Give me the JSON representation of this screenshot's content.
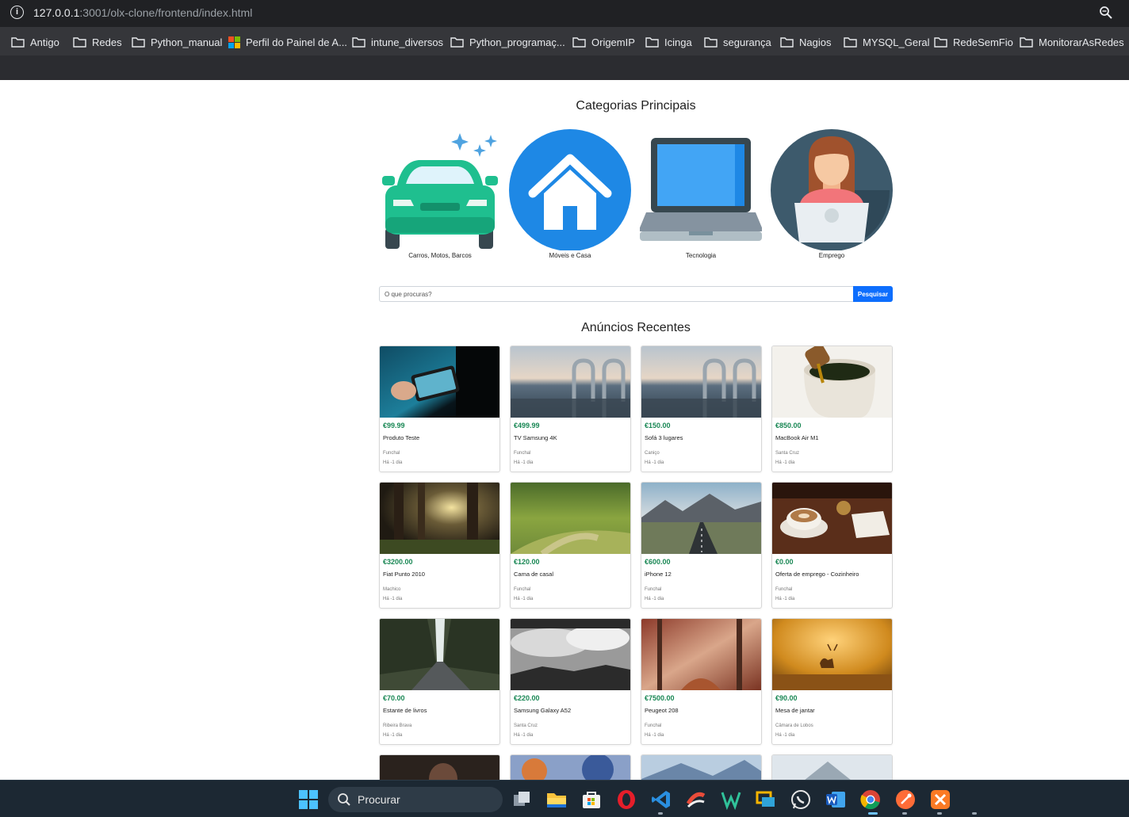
{
  "browser": {
    "url_host": "127.0.0.1",
    "url_rest": ":3001/olx-clone/frontend/index.html",
    "bookmarks": [
      "Antigo",
      "Redes",
      "Python_manual",
      "Perfil do Painel de A...",
      "intune_diversos",
      "Python_programaç...",
      "OrigemIP",
      "Icinga",
      "segurança",
      "Nagios",
      "MYSQL_Geral",
      "RedeSemFio",
      "MonitorarAsRedes"
    ]
  },
  "categories": {
    "title": "Categorias Principais",
    "items": [
      {
        "label": "Carros, Motos, Barcos",
        "icon": "car-icon"
      },
      {
        "label": "Móveis e Casa",
        "icon": "house-icon"
      },
      {
        "label": "Tecnologia",
        "icon": "laptop-icon"
      },
      {
        "label": "Emprego",
        "icon": "person-laptop-icon"
      }
    ]
  },
  "search": {
    "placeholder": "O que procuras?",
    "button": "Pesquisar"
  },
  "listings": {
    "title": "Anúncios Recentes",
    "items": [
      {
        "price": "€99.99",
        "title": "Produto Teste",
        "location": "Funchal",
        "date": "Há -1 dia"
      },
      {
        "price": "€499.99",
        "title": "TV Samsung 4K",
        "location": "Funchal",
        "date": "Há -1 dia"
      },
      {
        "price": "€150.00",
        "title": "Sofá 3 lugares",
        "location": "Caniço",
        "date": "Há -1 dia"
      },
      {
        "price": "€850.00",
        "title": "MacBook Air M1",
        "location": "Santa Cruz",
        "date": "Há -1 dia"
      },
      {
        "price": "€3200.00",
        "title": "Fiat Punto 2010",
        "location": "Machico",
        "date": "Há -1 dia"
      },
      {
        "price": "€120.00",
        "title": "Cama de casal",
        "location": "Funchal",
        "date": "Há -1 dia"
      },
      {
        "price": "€600.00",
        "title": "iPhone 12",
        "location": "Funchal",
        "date": "Há -1 dia"
      },
      {
        "price": "€0.00",
        "title": "Oferta de emprego - Cozinheiro",
        "location": "Funchal",
        "date": "Há -1 dia"
      },
      {
        "price": "€70.00",
        "title": "Estante de livros",
        "location": "Ribeira Brava",
        "date": "Há -1 dia"
      },
      {
        "price": "€220.00",
        "title": "Samsung Galaxy A52",
        "location": "Santa Cruz",
        "date": "Há -1 dia"
      },
      {
        "price": "€7500.00",
        "title": "Peugeot 208",
        "location": "Funchal",
        "date": "Há -1 dia"
      },
      {
        "price": "€90.00",
        "title": "Mesa de jantar",
        "location": "Câmara de Lobos",
        "date": "Há -1 dia"
      }
    ]
  },
  "taskbar": {
    "search_label": "Procurar"
  },
  "colors": {
    "price": "#198754",
    "primary_button": "#0d6efd"
  }
}
